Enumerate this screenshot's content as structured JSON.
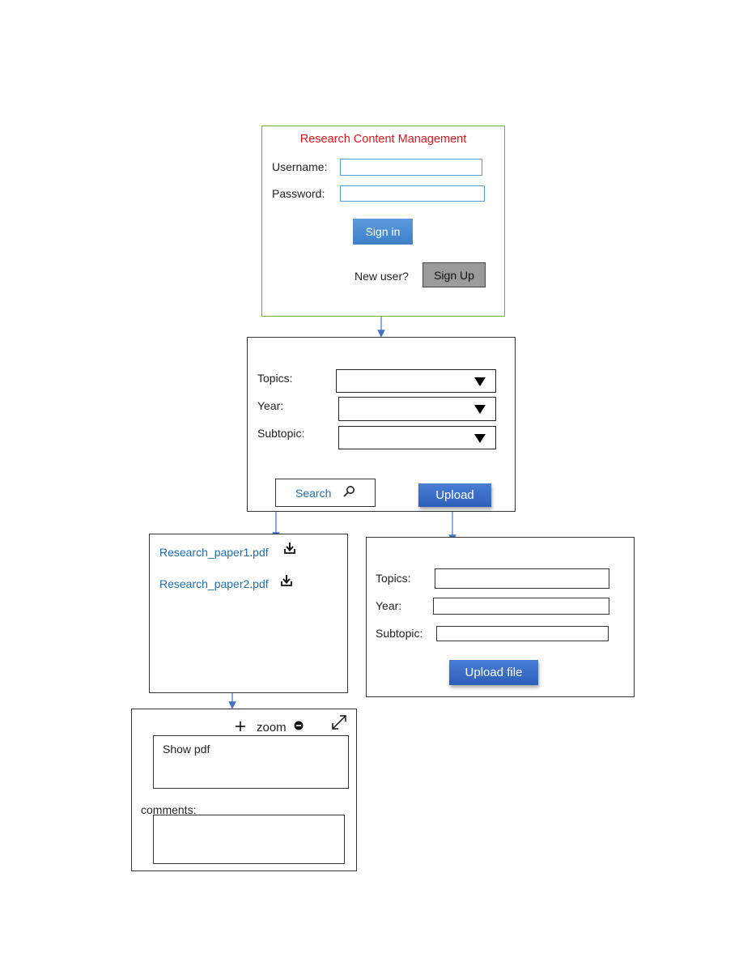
{
  "login": {
    "title": "Research Content Management",
    "username_label": "Username:",
    "password_label": "Password:",
    "sign_in_label": "Sign in",
    "new_user_label": "New user?",
    "sign_up_label": "Sign Up"
  },
  "search_panel": {
    "topics_label": "Topics:",
    "year_label": "Year:",
    "subtopic_label": "Subtopic:",
    "search_label": "Search",
    "upload_label": "Upload"
  },
  "results": {
    "files": [
      {
        "name": "Research_paper1.pdf"
      },
      {
        "name": "Research_paper2.pdf"
      }
    ]
  },
  "upload_form": {
    "topics_label": "Topics:",
    "year_label": "Year:",
    "subtopic_label": "Subtopic:",
    "upload_file_label": "Upload file"
  },
  "viewer": {
    "zoom_label": "zoom",
    "show_pdf_label": "Show pdf",
    "comments_label": "comments:"
  },
  "colors": {
    "login_border": "#70ad47",
    "title_red": "#e8141b",
    "input_border": "#5b9bd5",
    "link_blue": "#1f6fb2",
    "connector_blue": "#4472c4"
  },
  "icons": [
    "search-icon",
    "download-icon",
    "plus-icon",
    "minus-circle-icon",
    "expand-icon",
    "caret-down-icon"
  ]
}
